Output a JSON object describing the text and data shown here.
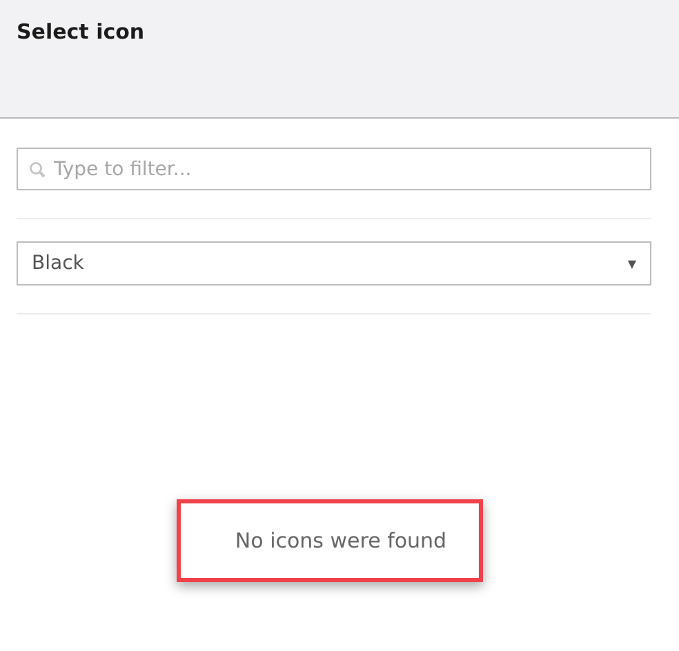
{
  "window": {
    "title": "Select icon"
  },
  "filter": {
    "placeholder": "Type to filter..."
  },
  "color_select": {
    "value": "Black",
    "arrow": "▼"
  },
  "empty_message": {
    "text": "No icons were found",
    "highlighted": true
  }
}
